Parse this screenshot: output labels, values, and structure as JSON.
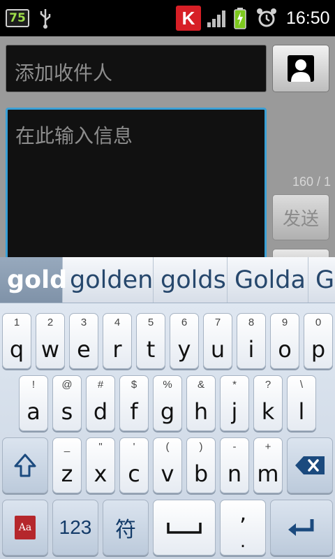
{
  "status_bar": {
    "battery_percent": "75",
    "time": "16:50",
    "icons": [
      "battery-percent-icon",
      "usb-icon",
      "k-app-icon",
      "signal-icon",
      "battery-icon",
      "alarm-icon"
    ],
    "accent_colors": {
      "battery_text": "#9edc4a",
      "k_app": "#d71f26"
    }
  },
  "compose": {
    "recipient_placeholder": "添加收件人",
    "message_placeholder": "在此输入信息",
    "char_counter": "160 / 1",
    "send_label": "发送",
    "focus_color": "#3aa0d6"
  },
  "suggestions": [
    "gold",
    "golden",
    "golds",
    "Golda",
    "Go"
  ],
  "keyboard": {
    "row1": [
      {
        "hint": "1",
        "key": "q"
      },
      {
        "hint": "2",
        "key": "w"
      },
      {
        "hint": "3",
        "key": "e"
      },
      {
        "hint": "4",
        "key": "r"
      },
      {
        "hint": "5",
        "key": "t"
      },
      {
        "hint": "6",
        "key": "y"
      },
      {
        "hint": "7",
        "key": "u"
      },
      {
        "hint": "8",
        "key": "i"
      },
      {
        "hint": "9",
        "key": "o"
      },
      {
        "hint": "0",
        "key": "p"
      }
    ],
    "row2": [
      {
        "hint": "!",
        "key": "a"
      },
      {
        "hint": "@",
        "key": "s"
      },
      {
        "hint": "#",
        "key": "d"
      },
      {
        "hint": "$",
        "key": "f"
      },
      {
        "hint": "%",
        "key": "g"
      },
      {
        "hint": "&",
        "key": "h"
      },
      {
        "hint": "*",
        "key": "j"
      },
      {
        "hint": "?",
        "key": "k"
      },
      {
        "hint": "\\",
        "key": "l"
      }
    ],
    "row3": [
      {
        "hint": "_",
        "key": "z"
      },
      {
        "hint": "\"",
        "key": "x"
      },
      {
        "hint": "'",
        "key": "c"
      },
      {
        "hint": "(",
        "key": "v"
      },
      {
        "hint": ")",
        "key": "b"
      },
      {
        "hint": "-",
        "key": "n"
      },
      {
        "hint": "+",
        "key": "m"
      }
    ],
    "num_label": "123",
    "symbol_label": "符",
    "dict_label": "Aa",
    "punct_label": "’",
    "punct_hint": "."
  }
}
